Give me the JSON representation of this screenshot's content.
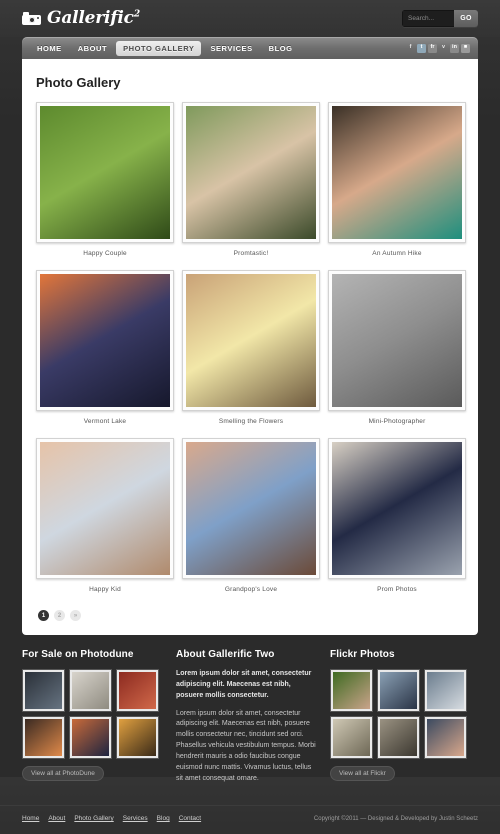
{
  "header": {
    "logo_text": "Gallerific",
    "logo_sup": "2",
    "logo_icon": "camera-icon",
    "search": {
      "placeholder": "Search...",
      "value": "",
      "button_label": "GO"
    }
  },
  "nav": {
    "items": [
      {
        "label": "HOME",
        "active": false
      },
      {
        "label": "ABOUT",
        "active": false
      },
      {
        "label": "PHOTO GALLERY",
        "active": true
      },
      {
        "label": "SERVICES",
        "active": false
      },
      {
        "label": "BLOG",
        "active": false
      }
    ],
    "social": [
      {
        "name": "facebook-icon",
        "glyph": "f"
      },
      {
        "name": "twitter-icon",
        "glyph": "t"
      },
      {
        "name": "flickr-icon",
        "glyph": "fr"
      },
      {
        "name": "vimeo-icon",
        "glyph": "v"
      },
      {
        "name": "linkedin-icon",
        "glyph": "in"
      },
      {
        "name": "rss-icon",
        "glyph": "■"
      }
    ]
  },
  "main": {
    "page_title": "Photo Gallery",
    "gallery": [
      {
        "caption": "Happy Couple",
        "c1": "#5d8a2e",
        "c2": "#87b24a",
        "c3": "#2f4a18"
      },
      {
        "caption": "Promtastic!",
        "c1": "#7f9a5c",
        "c2": "#d8c3a6",
        "c3": "#3b4a2a"
      },
      {
        "caption": "An Autumn Hike",
        "c1": "#3a3026",
        "c2": "#d7a98a",
        "c3": "#1e8f7e"
      },
      {
        "caption": "Vermont Lake",
        "c1": "#e2763a",
        "c2": "#3a3b66",
        "c3": "#16182c"
      },
      {
        "caption": "Smelling the Flowers",
        "c1": "#c9a277",
        "c2": "#f2e7a8",
        "c3": "#6e5a3e"
      },
      {
        "caption": "Mini-Photographer",
        "c1": "#b4b4b4",
        "c2": "#8e8e8e",
        "c3": "#5a5a5a"
      },
      {
        "caption": "Happy Kid",
        "c1": "#e6c3a8",
        "c2": "#cfd7e0",
        "c3": "#b08a6c"
      },
      {
        "caption": "Grandpop's Love",
        "c1": "#d9a98c",
        "c2": "#7fa0c8",
        "c3": "#6b4a38"
      },
      {
        "caption": "Prom Photos",
        "c1": "#d8d0c4",
        "c2": "#232a45",
        "c3": "#9aa2ae"
      }
    ],
    "pagination": [
      {
        "label": "1",
        "active": true
      },
      {
        "label": "2",
        "active": false
      },
      {
        "label": "»",
        "active": false
      }
    ]
  },
  "footer_widgets": {
    "photodune": {
      "title": "For Sale on Photodune",
      "button_label": "View all at PhotoDune",
      "thumbs": [
        {
          "c1": "#2a3038",
          "c2": "#667381"
        },
        {
          "c1": "#d8d4cc",
          "c2": "#8f8b80"
        },
        {
          "c1": "#8c2a20",
          "c2": "#d1694a"
        },
        {
          "c1": "#3a2a22",
          "c2": "#e08a4a"
        },
        {
          "c1": "#c86a3a",
          "c2": "#1e2440"
        },
        {
          "c1": "#e0a040",
          "c2": "#3a2a18"
        }
      ]
    },
    "about": {
      "title": "About Gallerific Two",
      "lead": "Lorem ipsum dolor sit amet, consectetur adipiscing elit. Maecenas est nibh, posuere mollis consectetur.",
      "body": "Lorem ipsum dolor sit amet, consectetur adipiscing elit. Maecenas est nibh, posuere mollis consectetur nec, tincidunt sed orci. Phasellus vehicula vestibulum tempus. Morbi hendrerit mauris a odio faucibus congue euismod nunc mattis. Vivamus luctus, tellus sit amet consequat ornare."
    },
    "flickr": {
      "title": "Flickr Photos",
      "button_label": "View all at Flickr",
      "thumbs": [
        {
          "c1": "#3f6b22",
          "c2": "#c9a38a"
        },
        {
          "c1": "#8aa0b4",
          "c2": "#2a3446"
        },
        {
          "c1": "#6b7d8e",
          "c2": "#d6dbe0"
        },
        {
          "c1": "#cfc8b4",
          "c2": "#6e6856"
        },
        {
          "c1": "#9a9282",
          "c2": "#3c3830"
        },
        {
          "c1": "#3b4a60",
          "c2": "#d9a88c"
        }
      ]
    }
  },
  "footer_bar": {
    "links": [
      "Home",
      "About",
      "Photo Gallery",
      "Services",
      "Blog",
      "Contact"
    ],
    "copyright": "Copyright ©2011 — Designed & Developed by Justin Scheetz"
  }
}
